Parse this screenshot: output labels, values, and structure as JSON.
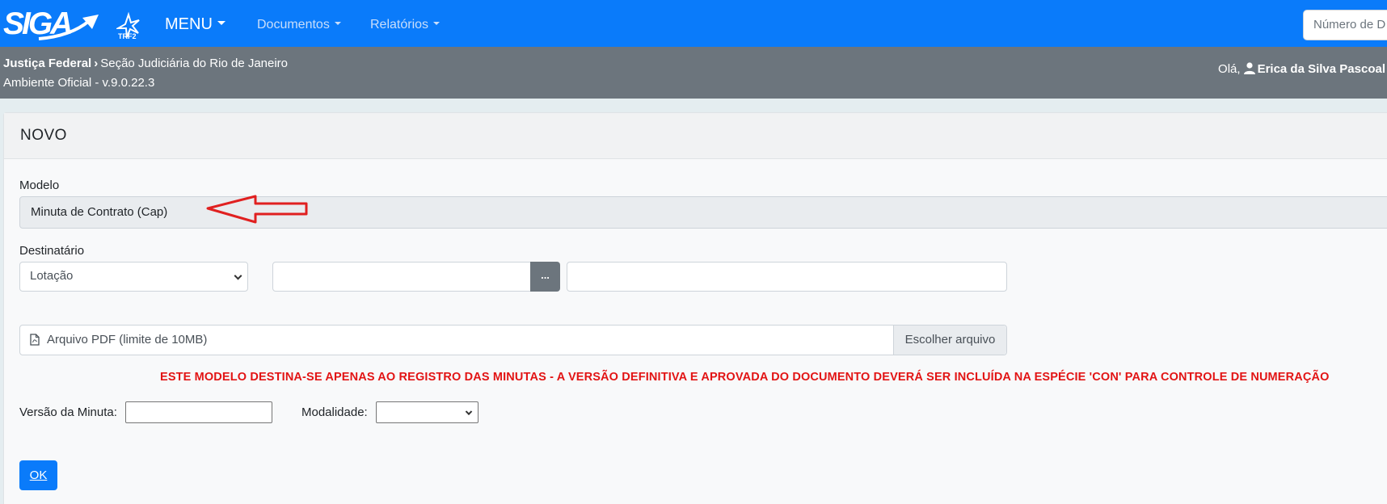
{
  "navbar": {
    "brand": "SIGA",
    "org_logo": "TRF2",
    "menu_label": "MENU",
    "links": [
      "Documentos",
      "Relatórios"
    ],
    "search_placeholder": "Número de D"
  },
  "infobar": {
    "crumb_root": "Justiça Federal",
    "crumb_section": "Seção Judiciária do Rio de Janeiro",
    "environment": "Ambiente Oficial - v.9.0.22.3",
    "greeting": "Olá,",
    "user_name": "Erica da Silva Pascoal"
  },
  "form": {
    "title": "NOVO",
    "modelo_label": "Modelo",
    "modelo_value": "Minuta de Contrato (Cap)",
    "destinatario_label": "Destinatário",
    "destinatario_selected": "Lotação",
    "lookup_button": "...",
    "file_placeholder": "Arquivo PDF (limite de 10MB)",
    "file_button": "Escolher arquivo",
    "warning": "ESTE MODELO DESTINA-SE APENAS AO REGISTRO DAS MINUTAS - A VERSÃO DEFINITIVA E APROVADA DO DOCUMENTO DEVERÁ SER INCLUÍDA NA ESPÉCIE 'CON' PARA CONTROLE DE NUMERAÇÃO",
    "versao_label": "Versão da Minuta:",
    "modalidade_label": "Modalidade:",
    "ok_button": "OK"
  },
  "colors": {
    "primary": "#0a7bfa",
    "infobar": "#6c757d",
    "warning": "#e21414",
    "annotation_arrow": "#e02020"
  }
}
